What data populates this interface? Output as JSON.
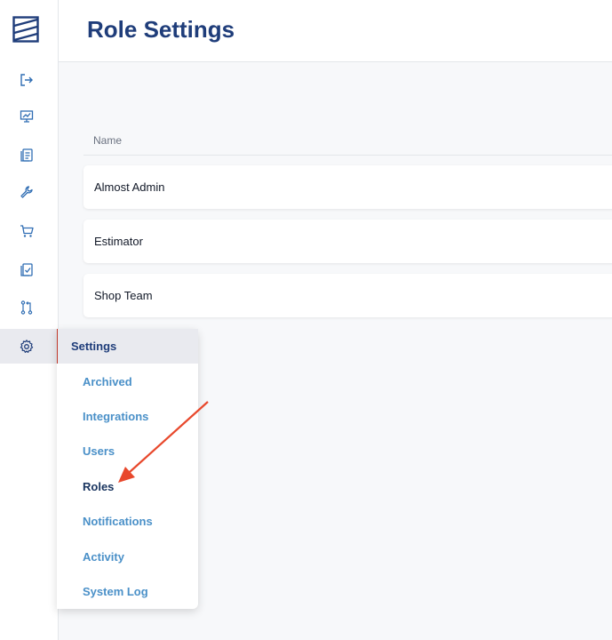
{
  "header": {
    "title": "Role Settings"
  },
  "table": {
    "column_name": "Name",
    "rows": [
      "Almost Admin",
      "Estimator",
      "Shop Team"
    ]
  },
  "sidebar": {
    "icons": [
      "logout-icon",
      "presentation-chart-icon",
      "clipboard-list-icon",
      "wrench-icon",
      "cart-icon",
      "clipboard-check-icon",
      "workflow-icon",
      "gear-icon"
    ]
  },
  "settings_menu": {
    "title": "Settings",
    "items": [
      "Archived",
      "Integrations",
      "Users",
      "Roles",
      "Notifications",
      "Activity",
      "System Log"
    ],
    "current": "Roles"
  },
  "colors": {
    "brand": "#1f3d7a",
    "link": "#4a90c8",
    "arrow": "#e8482c"
  }
}
